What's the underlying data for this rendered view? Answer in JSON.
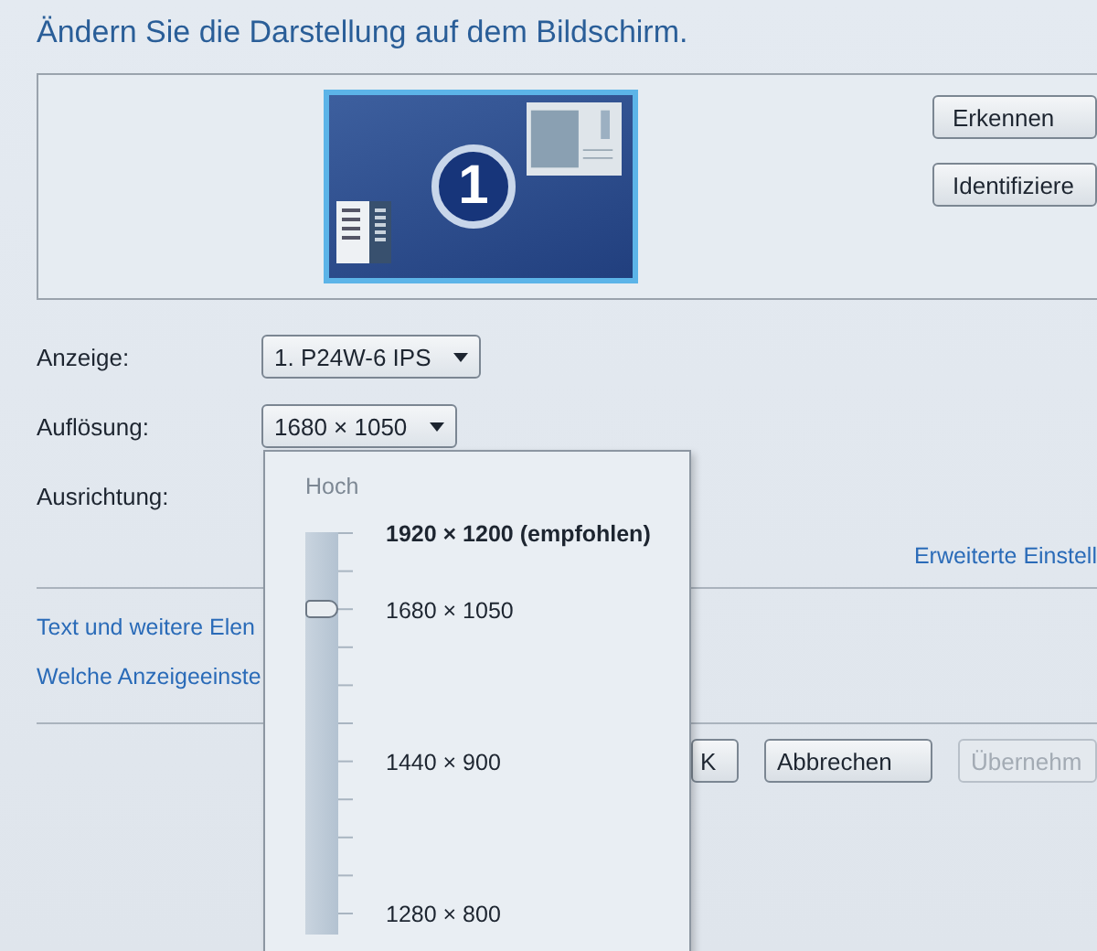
{
  "title": "Ändern Sie die Darstellung auf dem Bildschirm.",
  "preview": {
    "monitor_number": "1",
    "selected": true,
    "buttons": [
      "Erkennen",
      "Identifiziere"
    ]
  },
  "fields": [
    {
      "label": "Anzeige:",
      "value": "1. P24W-6 IPS"
    },
    {
      "label": "Auflösung:",
      "value": "1680 × 1050"
    },
    {
      "label": "Ausrichtung:"
    }
  ],
  "advanced_link": "Erweiterte Einstell",
  "links": [
    "Text und weitere Elen",
    "Welche Anzeigeeinste"
  ],
  "buttons": [
    {
      "label": "K",
      "disabled": false
    },
    {
      "label": "Abbrechen",
      "disabled": false
    },
    {
      "label": "Übernehm",
      "disabled": true
    }
  ],
  "resolution_popup": {
    "top_label": "Hoch",
    "level": 0.81,
    "options": [
      {
        "label": "1920 × 1200 (empfohlen)",
        "recommended": true
      },
      {
        "label": "1680 × 1050",
        "recommended": false
      },
      {
        "label": "1440 × 900",
        "recommended": false
      },
      {
        "label": "1280 × 800",
        "recommended": false
      }
    ]
  }
}
